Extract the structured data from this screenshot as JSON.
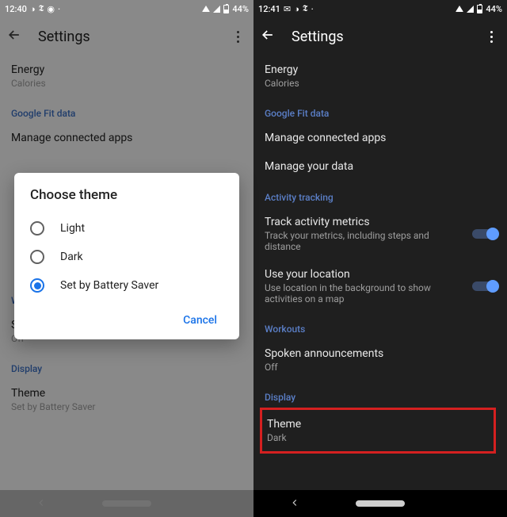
{
  "left": {
    "status": {
      "time": "12:40",
      "battery": "44%"
    },
    "title": "Settings",
    "energy": {
      "label": "Energy",
      "sub": "Calories"
    },
    "section_fit": "Google Fit data",
    "manage_apps": "Manage connected apps",
    "section_workouts": "Workouts",
    "spoken": {
      "label": "Spoken announcements",
      "sub": "Off"
    },
    "section_display": "Display",
    "theme": {
      "label": "Theme",
      "sub": "Set by Battery Saver"
    },
    "dialog": {
      "title": "Choose theme",
      "options": [
        "Light",
        "Dark",
        "Set by Battery Saver"
      ],
      "selected": 2,
      "cancel": "Cancel"
    }
  },
  "right": {
    "status": {
      "time": "12:41",
      "battery": "44%"
    },
    "title": "Settings",
    "energy": {
      "label": "Energy",
      "sub": "Calories"
    },
    "section_fit": "Google Fit data",
    "manage_apps": "Manage connected apps",
    "manage_data": "Manage your data",
    "section_activity": "Activity tracking",
    "track": {
      "label": "Track activity metrics",
      "sub": "Track your metrics, including steps and distance"
    },
    "location": {
      "label": "Use your location",
      "sub": "Use location in the background to show activities on a map"
    },
    "section_workouts": "Workouts",
    "spoken": {
      "label": "Spoken announcements",
      "sub": "Off"
    },
    "section_display": "Display",
    "theme": {
      "label": "Theme",
      "sub": "Dark"
    }
  }
}
